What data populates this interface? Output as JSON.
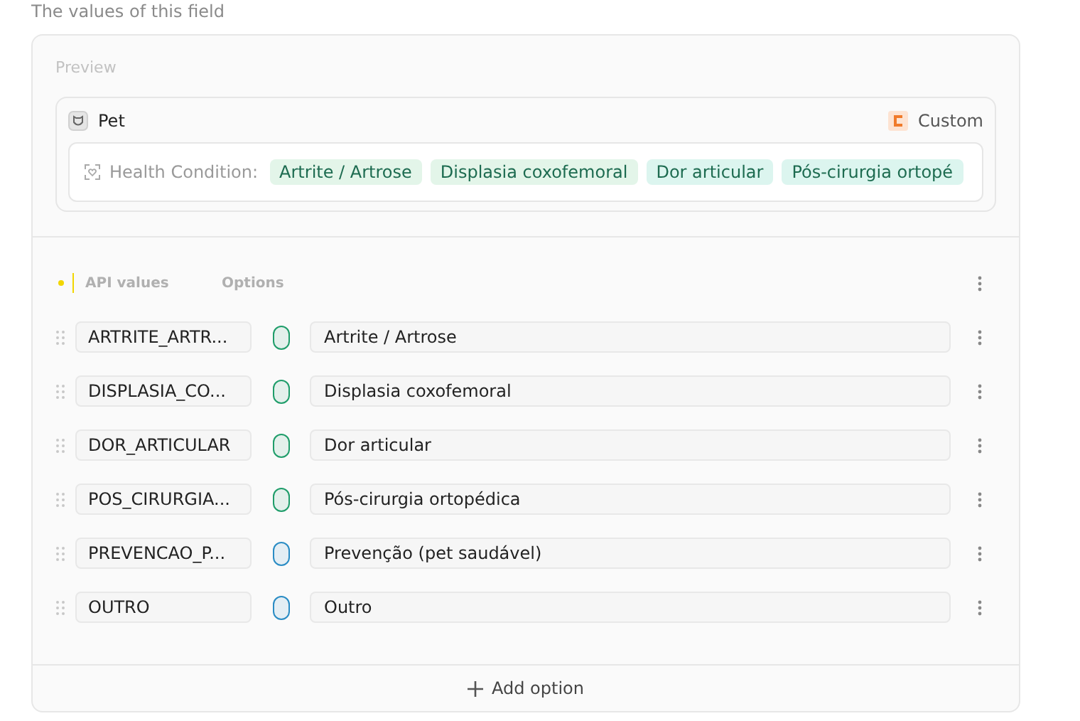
{
  "section_hint": "The values of this field",
  "preview": {
    "label": "Preview",
    "entity": "Pet",
    "badge": "Custom",
    "field_label": "Health Condition:",
    "tags": [
      {
        "text": "Artrite / Artrose",
        "color": "#e3f5e9"
      },
      {
        "text": "Displasia coxofemoral",
        "color": "#e3f5e9"
      },
      {
        "text": "Dor articular",
        "color": "#dcf5ef"
      },
      {
        "text": "Pós-cirurgia ortopé",
        "color": "#dcf5ef"
      }
    ]
  },
  "columns": {
    "api_values": "API values",
    "options": "Options"
  },
  "options": [
    {
      "api_value": "ARTRITE_ARTR...",
      "color": "#1f9d6a",
      "label": "Artrite / Artrose"
    },
    {
      "api_value": "DISPLASIA_CO...",
      "color": "#1f9d6a",
      "label": "Displasia coxofemoral"
    },
    {
      "api_value": "DOR_ARTICULAR",
      "color": "#1f9d6a",
      "label": "Dor articular"
    },
    {
      "api_value": "POS_CIRURGIA...",
      "color": "#1f9d6a",
      "label": "Pós-cirurgia ortopédica"
    },
    {
      "api_value": "PREVENCAO_P...",
      "color": "#2a8cc4",
      "label": "Prevenção (pet saudável)"
    },
    {
      "api_value": "OUTRO",
      "color": "#2a8cc4",
      "label": "Outro"
    }
  ],
  "add_button": "Add option"
}
